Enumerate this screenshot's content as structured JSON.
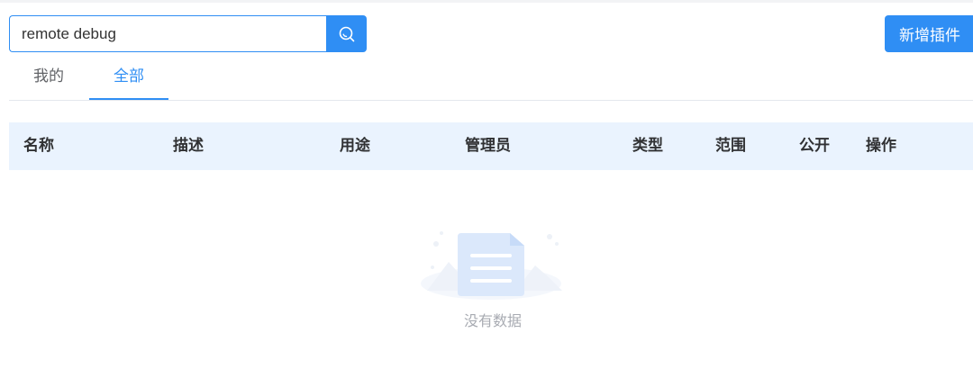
{
  "search": {
    "value": "remote debug",
    "placeholder": ""
  },
  "actions": {
    "add_label": "新增插件"
  },
  "tabs": [
    {
      "label": "我的",
      "active": false
    },
    {
      "label": "全部",
      "active": true
    }
  ],
  "table": {
    "columns": [
      "名称",
      "描述",
      "用途",
      "管理员",
      "类型",
      "范围",
      "公开",
      "操作"
    ],
    "rows": [],
    "empty_text": "没有数据"
  },
  "colors": {
    "accent": "#2f8ef4",
    "header_bg": "#eaf3fe",
    "empty_text": "#a8abb2"
  },
  "icons": {
    "search": "search-icon",
    "empty": "empty-folder-icon"
  }
}
